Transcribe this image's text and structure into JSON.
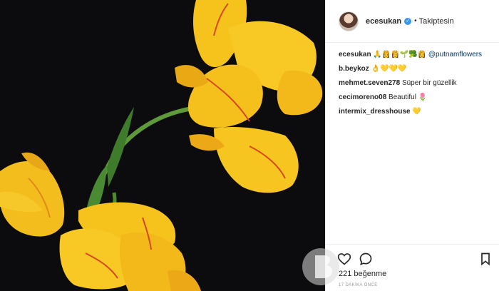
{
  "post": {
    "username": "ecesukan",
    "dot": "•",
    "follow_status": "Takiptesin",
    "verified_icon": "verified-badge-icon"
  },
  "caption": {
    "username": "ecesukan",
    "emojis": "🙏👸👸🌱🥦👸",
    "mention": "@putnamflowers"
  },
  "comments": [
    {
      "username": "b.beykoz",
      "text": "",
      "emoji": "👌💛💛💛"
    },
    {
      "username": "mehmet.seven278",
      "text": "Süper bir güzellik",
      "emoji": ""
    },
    {
      "username": "cecimoreno08",
      "text": "Beautiful",
      "emoji": "🌷"
    },
    {
      "username": "intermix_dresshouse",
      "text": "",
      "emoji": "💛"
    }
  ],
  "actions": {
    "like_icon": "heart-icon",
    "comment_icon": "comment-bubble-icon",
    "save_icon": "bookmark-icon"
  },
  "likes_text": "221 beğenme",
  "time_text": "17 DAKİKA ÖNCE",
  "colors": {
    "photo_bg": "#0c0c0e",
    "petal": "#f6c21c",
    "petal_dark": "#e69b12",
    "stem": "#5e9a3a",
    "verified": "#3897f0",
    "link": "#003569"
  }
}
